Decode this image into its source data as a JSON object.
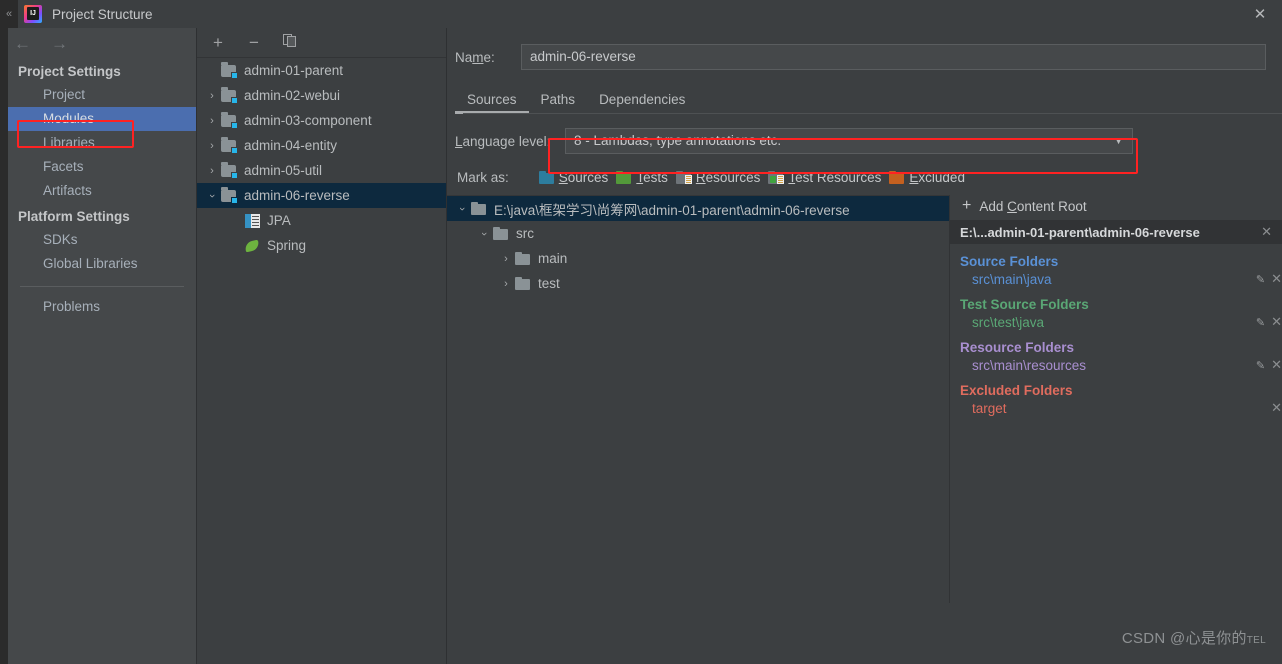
{
  "window": {
    "title": "Project Structure",
    "app_icon": "intellij-idea-icon",
    "close_icon": "✕",
    "edge_glyph": "«"
  },
  "nav": {
    "back_icon": "←",
    "forward_icon": "→"
  },
  "sidebar": {
    "groups": [
      {
        "title": "Project Settings",
        "items": [
          {
            "label": "Project",
            "selected": false
          },
          {
            "label": "Modules",
            "selected": true
          },
          {
            "label": "Libraries",
            "selected": false
          },
          {
            "label": "Facets",
            "selected": false
          },
          {
            "label": "Artifacts",
            "selected": false
          }
        ]
      },
      {
        "title": "Platform Settings",
        "items": [
          {
            "label": "SDKs",
            "selected": false
          },
          {
            "label": "Global Libraries",
            "selected": false
          }
        ]
      }
    ],
    "problems_label": "Problems",
    "selected_highlight_color": "#4b6eaf",
    "annotation_box_color": "#ff2222"
  },
  "module_panel": {
    "toolbar": {
      "add_label": "+",
      "remove_label": "−",
      "copy_label": "copy-icon"
    },
    "modules": [
      {
        "label": "admin-01-parent",
        "expandable": false,
        "expanded": false,
        "selected": false,
        "icon": "module-folder-icon"
      },
      {
        "label": "admin-02-webui",
        "expandable": true,
        "expanded": false,
        "selected": false,
        "icon": "module-folder-icon"
      },
      {
        "label": "admin-03-component",
        "expandable": true,
        "expanded": false,
        "selected": false,
        "icon": "module-folder-icon"
      },
      {
        "label": "admin-04-entity",
        "expandable": true,
        "expanded": false,
        "selected": false,
        "icon": "module-folder-icon"
      },
      {
        "label": "admin-05-util",
        "expandable": true,
        "expanded": false,
        "selected": false,
        "icon": "module-folder-icon"
      },
      {
        "label": "admin-06-reverse",
        "expandable": true,
        "expanded": true,
        "selected": true,
        "icon": "module-folder-icon"
      }
    ],
    "facets": [
      {
        "label": "JPA",
        "icon": "jpa-icon"
      },
      {
        "label": "Spring",
        "icon": "spring-leaf-icon"
      }
    ],
    "selected_color": "#0d293e"
  },
  "main": {
    "name_label": "Name:",
    "name_value": "admin-06-reverse",
    "tabs": [
      {
        "label": "Sources",
        "active": true
      },
      {
        "label": "Paths",
        "active": false
      },
      {
        "label": "Dependencies",
        "active": false
      }
    ],
    "language_level_label": "Language level:",
    "language_level_value": "8 - Lambdas, type annotations etc.",
    "language_level_caret": "▼",
    "mark_as_label": "Mark as:",
    "mark_as_items": [
      {
        "label": "Sources",
        "mnemonic": "S",
        "color": "#2d7d9e"
      },
      {
        "label": "Tests",
        "mnemonic": "T",
        "color": "#53993a"
      },
      {
        "label": "Resources",
        "mnemonic": "R",
        "color": "#6e7479"
      },
      {
        "label": "Test Resources",
        "mnemonic": "T",
        "color": "#6e7479"
      },
      {
        "label": "Excluded",
        "mnemonic": "E",
        "color": "#c4601f"
      }
    ]
  },
  "content_root_tree": {
    "rows": [
      {
        "label": "E:\\java\\框架学习\\尚筹网\\admin-01-parent\\admin-06-reverse",
        "depth": 0,
        "expanded": true,
        "selected": true
      },
      {
        "label": "src",
        "depth": 1,
        "expanded": true,
        "selected": false
      },
      {
        "label": "main",
        "depth": 2,
        "expanded": false,
        "selected": false
      },
      {
        "label": "test",
        "depth": 2,
        "expanded": false,
        "selected": false
      }
    ]
  },
  "folders_panel": {
    "add_content_root_label": "Add Content Root",
    "add_content_root_mnemonic": "C",
    "add_icon": "plus-icon",
    "content_root_path": "E:\\...admin-01-parent\\admin-06-reverse",
    "content_root_close_icon": "✕",
    "groups": [
      {
        "title": "Source Folders",
        "color": "#5a91d6",
        "entries": [
          {
            "path": "src\\main\\java",
            "has_edit": true,
            "has_remove": true
          }
        ]
      },
      {
        "title": "Test Source Folders",
        "color": "#5aa775",
        "entries": [
          {
            "path": "src\\test\\java",
            "has_edit": true,
            "has_remove": true
          }
        ]
      },
      {
        "title": "Resource Folders",
        "color": "#a98fd0",
        "entries": [
          {
            "path": "src\\main\\resources",
            "has_edit": true,
            "has_remove": true
          }
        ]
      },
      {
        "title": "Excluded Folders",
        "color": "#e06c5e",
        "entries": [
          {
            "path": "target",
            "has_edit": false,
            "has_remove": true
          }
        ]
      }
    ],
    "edit_icon": "✎",
    "remove_icon": "✕"
  },
  "watermark": {
    "prefix": "CSDN @心是你的",
    "suffix": "TEL"
  }
}
